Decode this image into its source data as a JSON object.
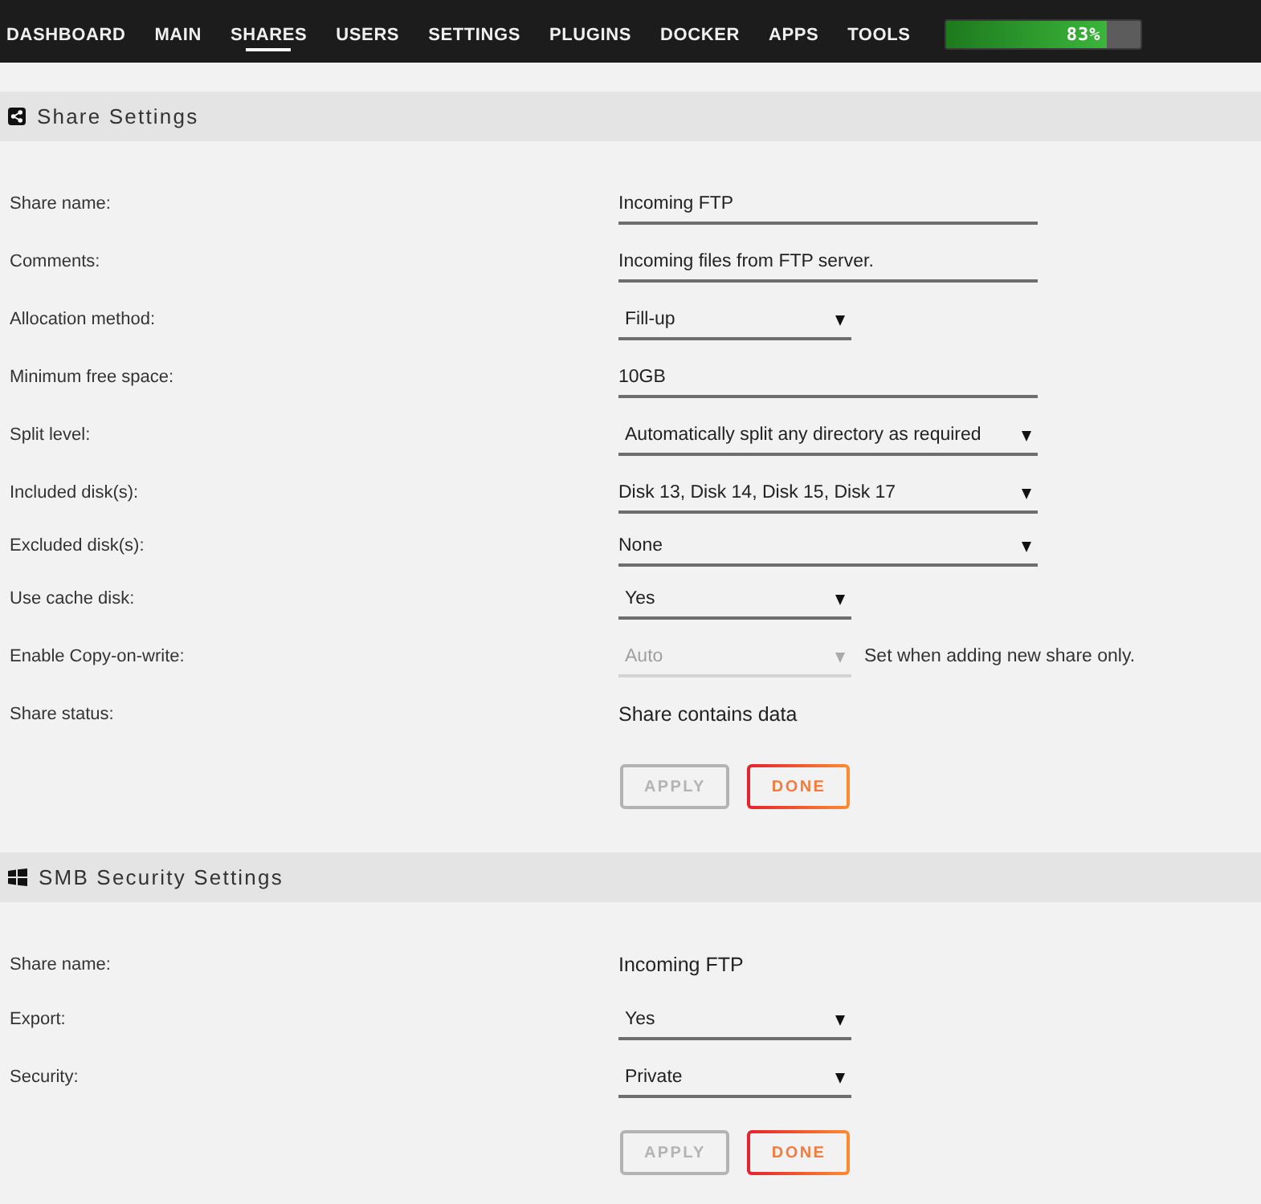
{
  "nav": {
    "items": [
      {
        "label": "DASHBOARD",
        "selected": false
      },
      {
        "label": "MAIN",
        "selected": false
      },
      {
        "label": "SHARES",
        "selected": true
      },
      {
        "label": "USERS",
        "selected": false
      },
      {
        "label": "SETTINGS",
        "selected": false
      },
      {
        "label": "PLUGINS",
        "selected": false
      },
      {
        "label": "DOCKER",
        "selected": false
      },
      {
        "label": "APPS",
        "selected": false
      },
      {
        "label": "TOOLS",
        "selected": false
      }
    ],
    "usage": {
      "level": 0.83,
      "reading": "83%"
    }
  },
  "sections": [
    {
      "title": "Share Settings",
      "fields": [
        {
          "label": "Share name:",
          "kind": "input",
          "value": "Incoming FTP",
          "disabled": false
        },
        {
          "label": "Comments:",
          "kind": "input",
          "value": "Incoming files from FTP server.",
          "disabled": false
        },
        {
          "label": "Allocation method:",
          "kind": "select",
          "value": "Fill-up",
          "disabled": false
        },
        {
          "label": "Minimum free space:",
          "kind": "input",
          "value": "10GB",
          "disabled": false
        },
        {
          "label": "Split level:",
          "kind": "long_select",
          "value": "Automatically split any directory as required",
          "disabled": false
        },
        {
          "label": "Included disk(s):",
          "kind": "multiselect",
          "value": "Disk 13, Disk 14, Disk 15, Disk 17",
          "disabled": false
        },
        {
          "label": "Excluded disk(s):",
          "kind": "multiselect",
          "value": "None",
          "disabled": false
        },
        {
          "label": "Use cache disk:",
          "kind": "select",
          "value": "Yes",
          "disabled": false
        },
        {
          "label": "Enable Copy-on-write:",
          "kind": "select",
          "value": "Auto",
          "disabled": true,
          "note": "Set when adding new share only."
        },
        {
          "label": "Share status:",
          "kind": "text",
          "value": "Share contains data",
          "disabled": false
        }
      ],
      "buttons": [
        {
          "label": "APPLY",
          "disabled": true
        },
        {
          "label": "DONE",
          "disabled": false
        }
      ]
    },
    {
      "title": "SMB Security Settings",
      "fields": [
        {
          "label": "Share name:",
          "kind": "text",
          "value": "Incoming FTP",
          "disabled": false
        },
        {
          "label": "Export:",
          "kind": "select",
          "value": "Yes",
          "disabled": false
        },
        {
          "label": "Security:",
          "kind": "select",
          "value": "Private",
          "disabled": false
        }
      ],
      "buttons": [
        {
          "label": "APPLY",
          "disabled": true
        },
        {
          "label": "DONE",
          "disabled": false
        }
      ]
    }
  ]
}
